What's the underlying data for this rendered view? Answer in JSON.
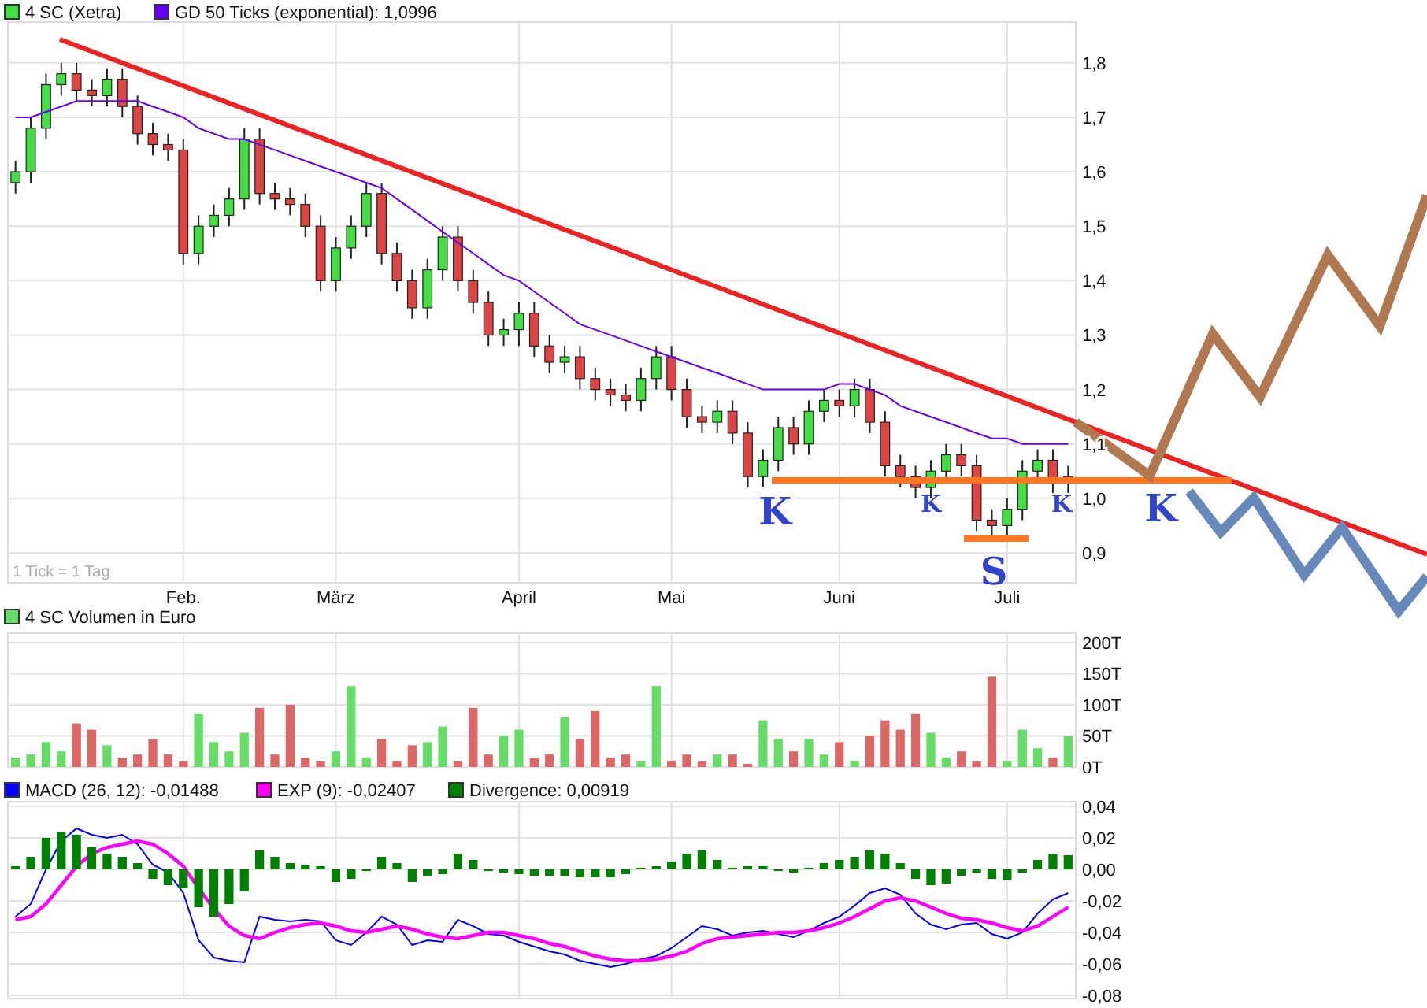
{
  "price_panel": {
    "note": "1 Tick = 1 Tag",
    "chart_data": {
      "type": "candlestick",
      "title": "4 SC (Xetra)",
      "grid": true,
      "legend": "top-left",
      "categories": [
        null,
        null,
        null,
        null,
        null,
        null,
        null,
        null,
        null,
        null,
        null,
        "Feb.",
        null,
        null,
        null,
        null,
        null,
        null,
        null,
        null,
        null,
        "März",
        null,
        null,
        null,
        null,
        null,
        null,
        null,
        null,
        null,
        null,
        null,
        "April",
        null,
        null,
        null,
        null,
        null,
        null,
        null,
        null,
        null,
        "Mai",
        null,
        null,
        null,
        null,
        null,
        null,
        null,
        null,
        null,
        null,
        "Juni",
        null,
        null,
        null,
        null,
        null,
        null,
        null,
        null,
        null,
        null,
        "Juli",
        null,
        null,
        null,
        null
      ],
      "ylim": [
        0.845,
        1.875
      ],
      "yticks": [
        {
          "value": 0.9,
          "label": "0,9"
        },
        {
          "value": 1.0,
          "label": "1,0"
        },
        {
          "value": 1.1,
          "label": "1,1"
        },
        {
          "value": 1.2,
          "label": "1,2"
        },
        {
          "value": 1.3,
          "label": "1,3"
        },
        {
          "value": 1.4,
          "label": "1,4"
        },
        {
          "value": 1.5,
          "label": "1,5"
        },
        {
          "value": 1.6,
          "label": "1,6"
        },
        {
          "value": 1.7,
          "label": "1,7"
        },
        {
          "value": 1.8,
          "label": "1,8"
        }
      ],
      "ohlc": [
        [
          1.58,
          1.62,
          1.56,
          1.6
        ],
        [
          1.6,
          1.7,
          1.58,
          1.68
        ],
        [
          1.68,
          1.78,
          1.66,
          1.76
        ],
        [
          1.76,
          1.8,
          1.74,
          1.78
        ],
        [
          1.78,
          1.8,
          1.73,
          1.75
        ],
        [
          1.75,
          1.77,
          1.72,
          1.74
        ],
        [
          1.74,
          1.79,
          1.72,
          1.77
        ],
        [
          1.77,
          1.79,
          1.7,
          1.72
        ],
        [
          1.72,
          1.74,
          1.65,
          1.67
        ],
        [
          1.67,
          1.69,
          1.63,
          1.65
        ],
        [
          1.65,
          1.67,
          1.62,
          1.64
        ],
        [
          1.64,
          1.66,
          1.43,
          1.45
        ],
        [
          1.45,
          1.52,
          1.43,
          1.5
        ],
        [
          1.5,
          1.54,
          1.48,
          1.52
        ],
        [
          1.52,
          1.57,
          1.5,
          1.55
        ],
        [
          1.55,
          1.68,
          1.53,
          1.66
        ],
        [
          1.66,
          1.68,
          1.54,
          1.56
        ],
        [
          1.56,
          1.58,
          1.53,
          1.55
        ],
        [
          1.55,
          1.57,
          1.52,
          1.54
        ],
        [
          1.54,
          1.56,
          1.48,
          1.5
        ],
        [
          1.5,
          1.52,
          1.38,
          1.4
        ],
        [
          1.4,
          1.48,
          1.38,
          1.46
        ],
        [
          1.46,
          1.52,
          1.44,
          1.5
        ],
        [
          1.5,
          1.58,
          1.48,
          1.56
        ],
        [
          1.56,
          1.58,
          1.43,
          1.45
        ],
        [
          1.45,
          1.47,
          1.38,
          1.4
        ],
        [
          1.4,
          1.42,
          1.33,
          1.35
        ],
        [
          1.35,
          1.44,
          1.33,
          1.42
        ],
        [
          1.42,
          1.5,
          1.4,
          1.48
        ],
        [
          1.48,
          1.5,
          1.38,
          1.4
        ],
        [
          1.4,
          1.42,
          1.34,
          1.36
        ],
        [
          1.36,
          1.38,
          1.28,
          1.3
        ],
        [
          1.3,
          1.33,
          1.28,
          1.31
        ],
        [
          1.31,
          1.36,
          1.28,
          1.34
        ],
        [
          1.34,
          1.36,
          1.26,
          1.28
        ],
        [
          1.28,
          1.3,
          1.23,
          1.25
        ],
        [
          1.25,
          1.28,
          1.23,
          1.26
        ],
        [
          1.26,
          1.28,
          1.2,
          1.22
        ],
        [
          1.22,
          1.24,
          1.18,
          1.2
        ],
        [
          1.2,
          1.22,
          1.17,
          1.19
        ],
        [
          1.19,
          1.21,
          1.16,
          1.18
        ],
        [
          1.18,
          1.24,
          1.16,
          1.22
        ],
        [
          1.22,
          1.28,
          1.2,
          1.26
        ],
        [
          1.26,
          1.28,
          1.18,
          1.2
        ],
        [
          1.2,
          1.22,
          1.13,
          1.15
        ],
        [
          1.15,
          1.17,
          1.12,
          1.14
        ],
        [
          1.14,
          1.18,
          1.12,
          1.16
        ],
        [
          1.16,
          1.18,
          1.1,
          1.12
        ],
        [
          1.12,
          1.14,
          1.02,
          1.04
        ],
        [
          1.04,
          1.09,
          1.02,
          1.07
        ],
        [
          1.07,
          1.15,
          1.05,
          1.13
        ],
        [
          1.13,
          1.15,
          1.08,
          1.1
        ],
        [
          1.1,
          1.18,
          1.08,
          1.16
        ],
        [
          1.16,
          1.2,
          1.14,
          1.18
        ],
        [
          1.18,
          1.2,
          1.15,
          1.17
        ],
        [
          1.17,
          1.22,
          1.15,
          1.2
        ],
        [
          1.2,
          1.22,
          1.12,
          1.14
        ],
        [
          1.14,
          1.16,
          1.04,
          1.06
        ],
        [
          1.06,
          1.08,
          1.02,
          1.04
        ],
        [
          1.04,
          1.06,
          1.0,
          1.02
        ],
        [
          1.02,
          1.07,
          1.0,
          1.05
        ],
        [
          1.05,
          1.1,
          1.03,
          1.08
        ],
        [
          1.08,
          1.1,
          1.04,
          1.06
        ],
        [
          1.06,
          1.08,
          0.94,
          0.96
        ],
        [
          0.96,
          0.98,
          0.93,
          0.95
        ],
        [
          0.95,
          1.0,
          0.93,
          0.98
        ],
        [
          0.98,
          1.07,
          0.96,
          1.05
        ],
        [
          1.05,
          1.09,
          1.03,
          1.07
        ],
        [
          1.07,
          1.09,
          1.01,
          1.03
        ],
        [
          1.03,
          1.06,
          1.01,
          1.04
        ]
      ],
      "series": [
        {
          "name": "GD 50 Ticks (exponential): 1,0996",
          "color": "#6600ff",
          "type": "line",
          "values": [
            1.7,
            1.7,
            1.71,
            1.72,
            1.73,
            1.73,
            1.73,
            1.73,
            1.73,
            1.72,
            1.71,
            1.7,
            1.68,
            1.67,
            1.66,
            1.66,
            1.65,
            1.64,
            1.63,
            1.62,
            1.61,
            1.6,
            1.59,
            1.58,
            1.57,
            1.55,
            1.53,
            1.51,
            1.49,
            1.47,
            1.45,
            1.43,
            1.41,
            1.4,
            1.38,
            1.36,
            1.34,
            1.32,
            1.31,
            1.3,
            1.29,
            1.28,
            1.27,
            1.26,
            1.25,
            1.24,
            1.23,
            1.22,
            1.21,
            1.2,
            1.2,
            1.2,
            1.2,
            1.2,
            1.21,
            1.21,
            1.2,
            1.19,
            1.17,
            1.16,
            1.15,
            1.14,
            1.13,
            1.12,
            1.11,
            1.11,
            1.1,
            1.1,
            1.1,
            1.1
          ]
        }
      ],
      "annotations": [
        "K",
        "K",
        "S",
        "K",
        "K"
      ]
    }
  },
  "volume_panel": {
    "chart_data": {
      "type": "bar",
      "grid": true,
      "legend": "top-left",
      "categories": [
        null,
        null,
        null,
        null,
        null,
        null,
        null,
        null,
        null,
        null,
        null,
        null,
        null,
        null,
        null,
        null,
        null,
        null,
        null,
        null,
        null,
        null,
        null,
        null,
        null,
        null,
        null,
        null,
        null,
        null,
        null,
        null,
        null,
        null,
        null,
        null,
        null,
        null,
        null,
        null,
        null,
        null,
        null,
        null,
        null,
        null,
        null,
        null,
        null,
        null,
        null,
        null,
        null,
        null,
        null,
        null,
        null,
        null,
        null,
        null,
        null,
        null,
        null,
        null,
        null,
        null,
        null,
        null,
        null,
        null
      ],
      "ylim": [
        0,
        215
      ],
      "yticks": [
        {
          "value": 0,
          "label": "0T"
        },
        {
          "value": 50,
          "label": "50T"
        },
        {
          "value": 100,
          "label": "100T"
        },
        {
          "value": 150,
          "label": "150T"
        },
        {
          "value": 200,
          "label": "200T"
        }
      ],
      "series": [
        {
          "name": "4 SC Volumen in Euro",
          "color": "#66dd66",
          "values": [
            15,
            20,
            40,
            25,
            70,
            60,
            35,
            15,
            20,
            45,
            20,
            10,
            85,
            40,
            25,
            55,
            95,
            20,
            100,
            15,
            10,
            25,
            130,
            15,
            45,
            10,
            35,
            40,
            65,
            10,
            95,
            20,
            50,
            60,
            15,
            20,
            80,
            45,
            90,
            15,
            20,
            10,
            130,
            10,
            20,
            10,
            20,
            20,
            5,
            75,
            45,
            25,
            45,
            20,
            40,
            10,
            50,
            75,
            60,
            85,
            55,
            15,
            25,
            10,
            145,
            10,
            60,
            30,
            15,
            50
          ],
          "colors": [
            "#66dd66",
            "#66dd66",
            "#66dd66",
            "#66dd66",
            "#dd6666",
            "#dd6666",
            "#66dd66",
            "#dd6666",
            "#dd6666",
            "#dd6666",
            "#dd6666",
            "#dd6666",
            "#66dd66",
            "#66dd66",
            "#66dd66",
            "#66dd66",
            "#dd6666",
            "#dd6666",
            "#dd6666",
            "#dd6666",
            "#dd6666",
            "#66dd66",
            "#66dd66",
            "#66dd66",
            "#dd6666",
            "#dd6666",
            "#dd6666",
            "#66dd66",
            "#66dd66",
            "#dd6666",
            "#dd6666",
            "#dd6666",
            "#66dd66",
            "#66dd66",
            "#dd6666",
            "#dd6666",
            "#66dd66",
            "#dd6666",
            "#dd6666",
            "#dd6666",
            "#dd6666",
            "#66dd66",
            "#66dd66",
            "#dd6666",
            "#dd6666",
            "#dd6666",
            "#66dd66",
            "#dd6666",
            "#dd6666",
            "#66dd66",
            "#66dd66",
            "#dd6666",
            "#66dd66",
            "#66dd66",
            "#dd6666",
            "#66dd66",
            "#dd6666",
            "#dd6666",
            "#dd6666",
            "#dd6666",
            "#66dd66",
            "#66dd66",
            "#dd6666",
            "#dd6666",
            "#dd6666",
            "#66dd66",
            "#66dd66",
            "#66dd66",
            "#dd6666",
            "#66dd66"
          ]
        }
      ]
    }
  },
  "macd_panel": {
    "chart_data": {
      "type": "line",
      "grid": true,
      "legend": "top-left",
      "categories": [
        null,
        null,
        null,
        null,
        null,
        null,
        null,
        null,
        null,
        null,
        null,
        null,
        null,
        null,
        null,
        null,
        null,
        null,
        null,
        null,
        null,
        null,
        null,
        null,
        null,
        null,
        null,
        null,
        null,
        null,
        null,
        null,
        null,
        null,
        null,
        null,
        null,
        null,
        null,
        null,
        null,
        null,
        null,
        null,
        null,
        null,
        null,
        null,
        null,
        null,
        null,
        null,
        null,
        null,
        null,
        null,
        null,
        null,
        null,
        null,
        null,
        null,
        null,
        null,
        null,
        null,
        null,
        null,
        null,
        null
      ],
      "ylim": [
        -0.082,
        0.043
      ],
      "yticks": [
        {
          "value": -0.08,
          "label": "-0,08"
        },
        {
          "value": -0.06,
          "label": "-0,06"
        },
        {
          "value": -0.04,
          "label": "-0,04"
        },
        {
          "value": -0.02,
          "label": "-0,02"
        },
        {
          "value": 0,
          "label": "0,00"
        },
        {
          "value": 0.02,
          "label": "0,02"
        },
        {
          "value": 0.04,
          "label": "0,04"
        }
      ],
      "series": [
        {
          "name": "MACD (26, 12): -0,01488",
          "color": "#0000ff",
          "values": [
            -0.03,
            -0.022,
            0.0,
            0.018,
            0.026,
            0.022,
            0.02,
            0.022,
            0.016,
            0.003,
            -0.002,
            -0.015,
            -0.045,
            -0.056,
            -0.058,
            -0.059,
            -0.03,
            -0.032,
            -0.033,
            -0.032,
            -0.033,
            -0.045,
            -0.048,
            -0.04,
            -0.03,
            -0.035,
            -0.048,
            -0.045,
            -0.046,
            -0.032,
            -0.036,
            -0.041,
            -0.042,
            -0.046,
            -0.049,
            -0.052,
            -0.054,
            -0.058,
            -0.06,
            -0.062,
            -0.06,
            -0.057,
            -0.055,
            -0.05,
            -0.043,
            -0.036,
            -0.038,
            -0.042,
            -0.04,
            -0.039,
            -0.041,
            -0.043,
            -0.039,
            -0.034,
            -0.03,
            -0.023,
            -0.015,
            -0.012,
            -0.016,
            -0.028,
            -0.035,
            -0.038,
            -0.035,
            -0.034,
            -0.041,
            -0.044,
            -0.04,
            -0.028,
            -0.019,
            -0.015
          ]
        },
        {
          "name": "EXP (9): -0,02407",
          "color": "#ff00ff",
          "values": [
            -0.032,
            -0.03,
            -0.022,
            -0.01,
            0.002,
            0.01,
            0.014,
            0.016,
            0.018,
            0.016,
            0.01,
            0.002,
            -0.012,
            -0.025,
            -0.036,
            -0.042,
            -0.044,
            -0.04,
            -0.037,
            -0.035,
            -0.034,
            -0.036,
            -0.039,
            -0.04,
            -0.038,
            -0.036,
            -0.038,
            -0.041,
            -0.043,
            -0.044,
            -0.042,
            -0.04,
            -0.04,
            -0.042,
            -0.044,
            -0.047,
            -0.049,
            -0.052,
            -0.055,
            -0.057,
            -0.058,
            -0.058,
            -0.057,
            -0.055,
            -0.052,
            -0.047,
            -0.044,
            -0.043,
            -0.042,
            -0.041,
            -0.04,
            -0.04,
            -0.039,
            -0.037,
            -0.034,
            -0.03,
            -0.025,
            -0.02,
            -0.018,
            -0.02,
            -0.024,
            -0.028,
            -0.031,
            -0.032,
            -0.034,
            -0.037,
            -0.039,
            -0.036,
            -0.03,
            -0.024
          ]
        },
        {
          "name": "Divergence: 0,00919",
          "color": "#008000",
          "type": "bar",
          "values": [
            0.002,
            0.008,
            0.02,
            0.024,
            0.022,
            0.014,
            0.01,
            0.008,
            0.004,
            -0.006,
            -0.01,
            -0.012,
            -0.024,
            -0.03,
            -0.022,
            -0.014,
            0.012,
            0.008,
            0.004,
            0.003,
            0.002,
            -0.008,
            -0.006,
            0.0,
            0.008,
            0.004,
            -0.008,
            -0.004,
            -0.003,
            0.01,
            0.006,
            -0.001,
            -0.002,
            -0.003,
            -0.004,
            -0.004,
            -0.004,
            -0.005,
            -0.005,
            -0.005,
            -0.003,
            0.001,
            0.002,
            0.005,
            0.01,
            0.012,
            0.006,
            0.001,
            0.002,
            0.002,
            -0.001,
            -0.002,
            0.001,
            0.004,
            0.006,
            0.008,
            0.012,
            0.01,
            0.004,
            -0.006,
            -0.01,
            -0.009,
            -0.004,
            -0.002,
            -0.006,
            -0.007,
            -0.002,
            0.006,
            0.01,
            0.009
          ]
        }
      ]
    }
  }
}
